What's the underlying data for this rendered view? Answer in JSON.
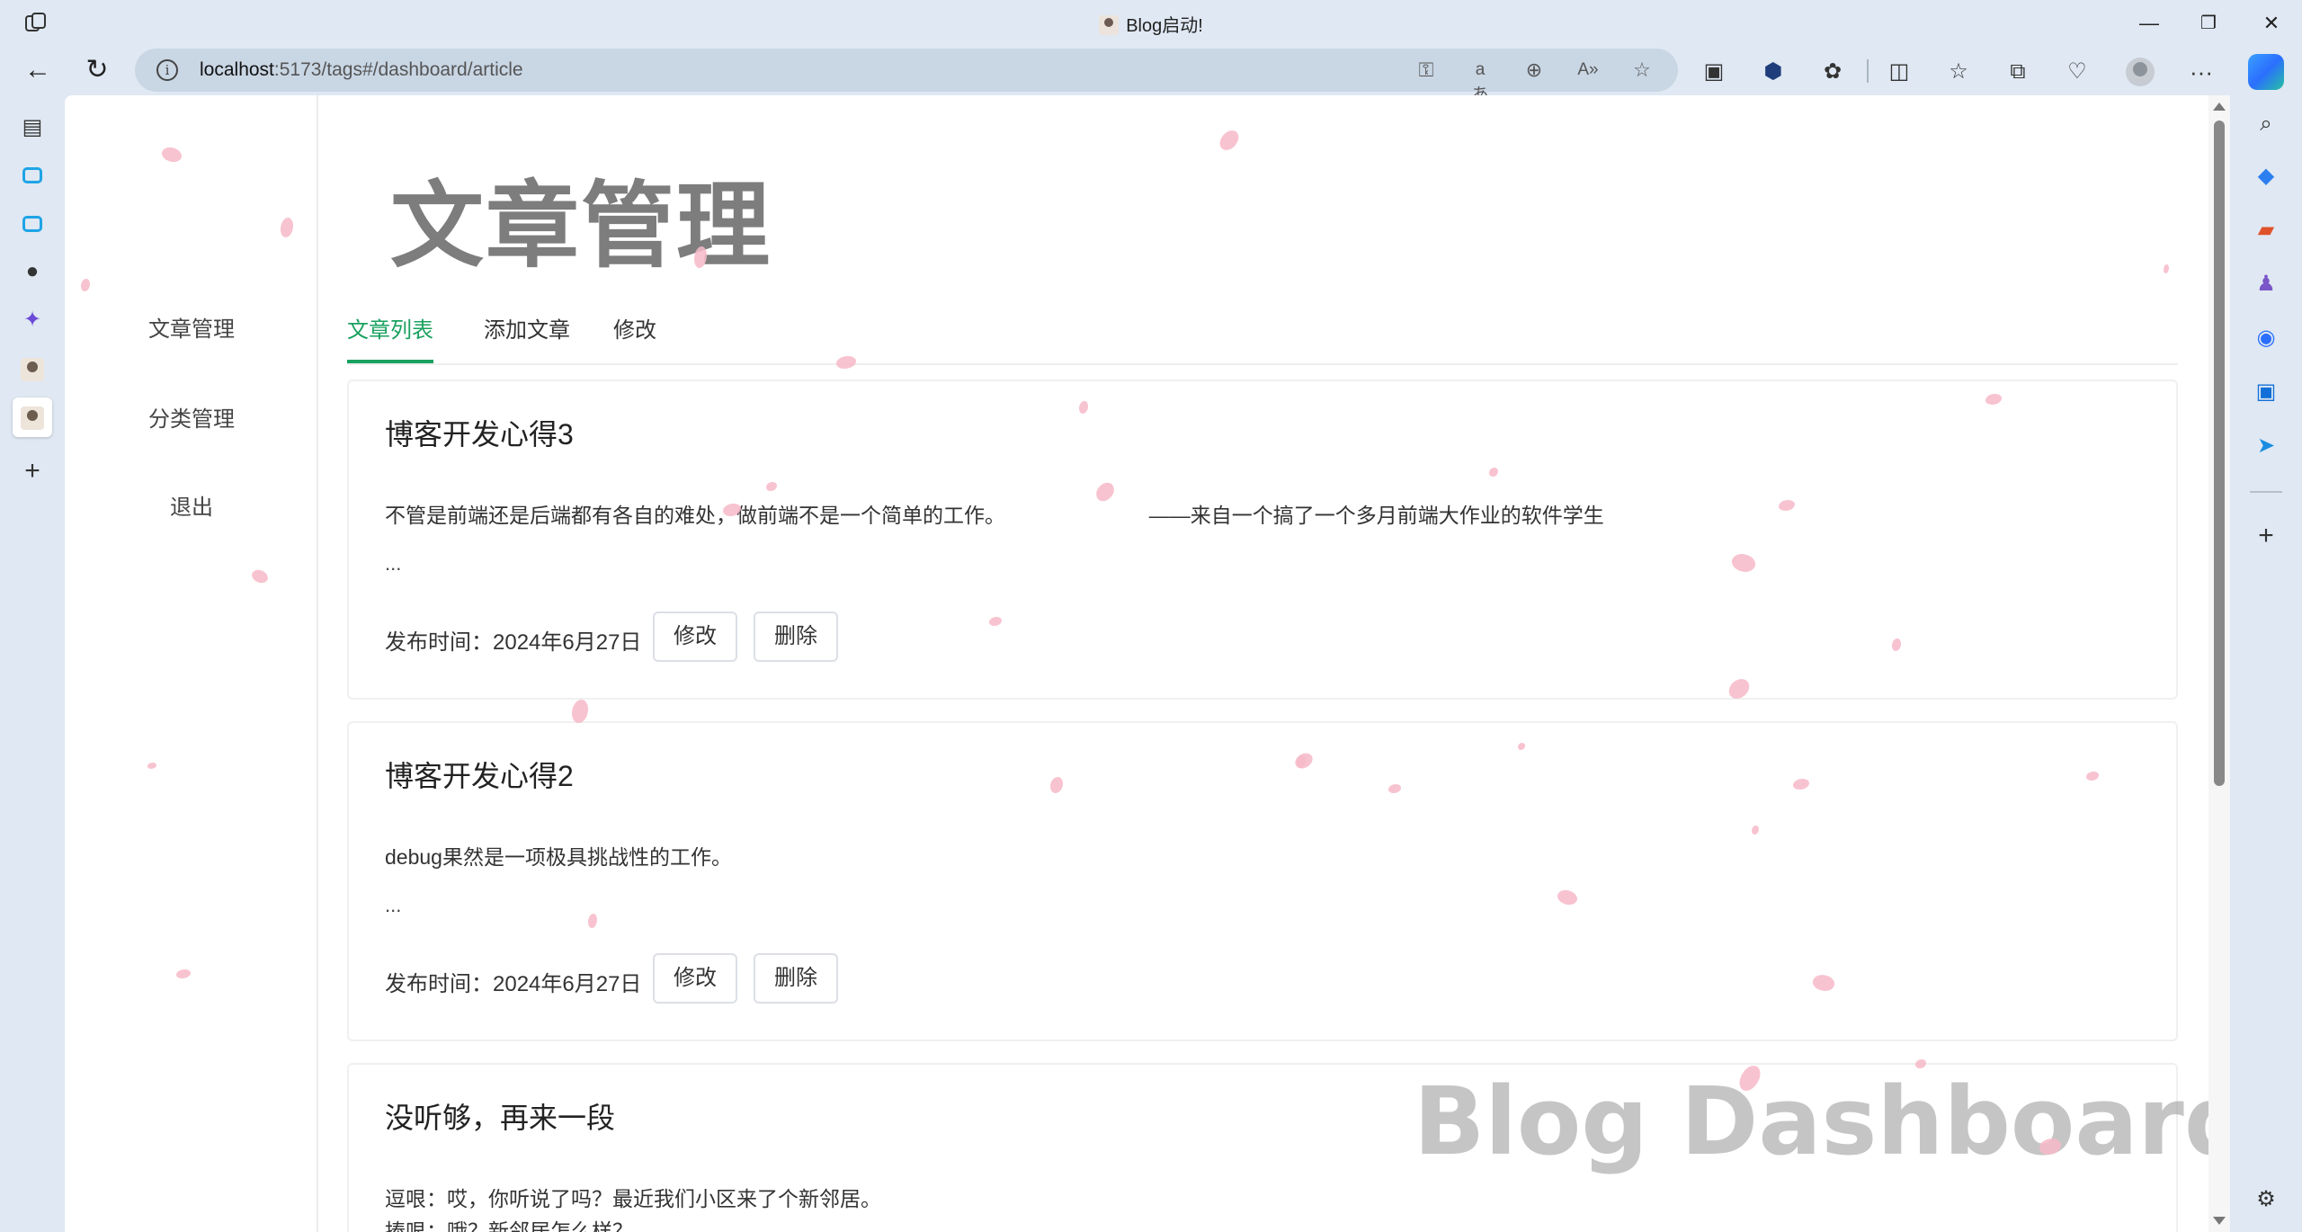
{
  "window": {
    "tab_title": "Blog启动!",
    "controls": {
      "minimize": "—",
      "restore": "❐",
      "close": "✕"
    }
  },
  "toolbar": {
    "back": "←",
    "reload": "↻",
    "info": "i",
    "url_host": "localhost",
    "url_path": ":5173/tags#/dashboard/article",
    "more": "···"
  },
  "sidebar": {
    "items": [
      {
        "label": "文章管理"
      },
      {
        "label": "分类管理"
      },
      {
        "label": "退出"
      }
    ]
  },
  "page": {
    "title": "文章管理",
    "tabs": [
      {
        "label": "文章列表",
        "active": true
      },
      {
        "label": "添加文章",
        "active": false
      },
      {
        "label": "修改",
        "active": false
      }
    ],
    "watermark": "Blog Dashboard"
  },
  "articles": [
    {
      "title": "博客开发心得3",
      "summary": "不管是前端还是后端都有各自的难处，做前端不是一个简单的工作。                         ——来自一个搞了一个多月前端大作业的软件学生",
      "ellipsis": "...",
      "date": "发布时间：2024年6月27日",
      "edit_label": "修改",
      "delete_label": "删除"
    },
    {
      "title": "博客开发心得2",
      "summary": "debug果然是一项极具挑战性的工作。",
      "ellipsis": "...",
      "date": "发布时间：2024年6月27日",
      "edit_label": "修改",
      "delete_label": "删除"
    },
    {
      "title": "没听够，再来一段",
      "summary": "逗哏：哎，你听说了吗？最近我们小区来了个新邻居。",
      "summary2": "捧哏：哦？新邻居怎么样？"
    }
  ],
  "colors": {
    "accent": "#19a15f",
    "petal": "#f7b8c8",
    "title_gray": "#7d7d7d"
  }
}
